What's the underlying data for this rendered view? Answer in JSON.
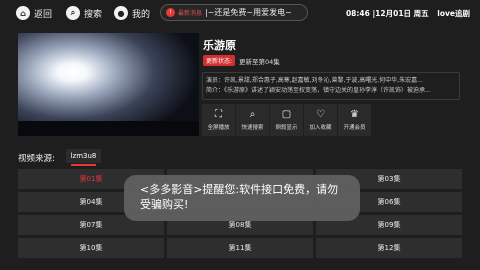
{
  "nav": {
    "back": "返回",
    "search": "搜索",
    "mine": "我的"
  },
  "news": {
    "tag": "最新消息",
    "text": "|~还是免费~用爱发电~"
  },
  "status": {
    "time": "08:46",
    "date": "|12月01日 周五",
    "app_name": "love追剧"
  },
  "detail": {
    "title": "乐游原",
    "update_label": "更新状态:",
    "update_value": "更新至第04集",
    "cast": "演员：许凯,景甜,郑合惠子,高寒,赵嘉敏,刘冬沁,曾黎,于波,高曙光,何中华,朱宏嘉...",
    "synopsis": "简介：《乐游原》讲述了颖安动荡至权变荡，镇守边关的皇孙李淳（许凯饰）被迫承..."
  },
  "actions": [
    {
      "icon": "fullscreen-icon",
      "glyph": "⛶",
      "label": "全屏播放"
    },
    {
      "icon": "search-icon",
      "glyph": "⌕",
      "label": "快速搜索"
    },
    {
      "icon": "display-icon",
      "glyph": "▢",
      "label": "倒叙显示"
    },
    {
      "icon": "favorite-icon",
      "glyph": "♡",
      "label": "加入收藏"
    },
    {
      "icon": "vip-icon",
      "glyph": "♛",
      "label": "开通会员"
    }
  ],
  "source": {
    "label": "视频来源:",
    "current": "lzm3u8"
  },
  "episodes": [
    "第01集",
    "",
    "第03集",
    "第04集",
    "",
    "第06集",
    "第07集",
    "第08集",
    "第09集",
    "第10集",
    "第11集",
    "第12集"
  ],
  "toast": {
    "text": "<多多影音>提醒您:软件接口免费，请勿受骗购买!"
  },
  "colors": {
    "accent": "#e53935",
    "background": "#1e1e1e",
    "tile": "#2e2e2e"
  }
}
